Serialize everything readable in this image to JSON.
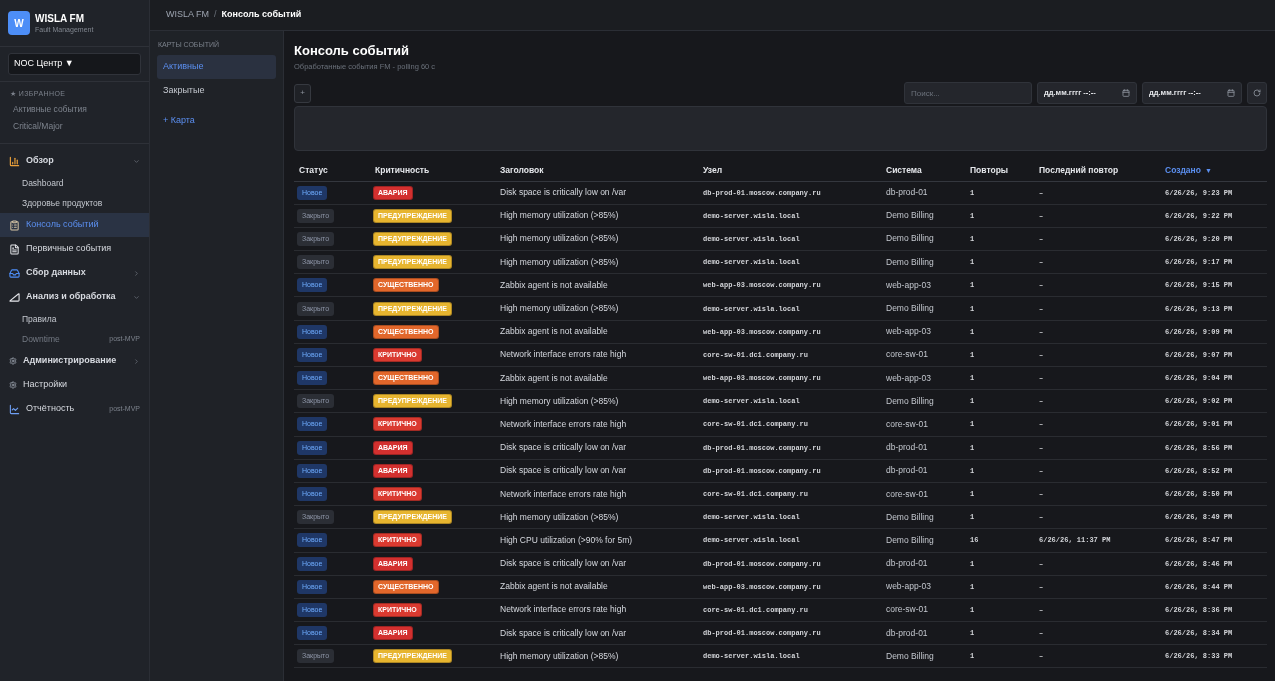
{
  "header": {
    "separator": "/",
    "breadcrumb": [
      {
        "label": "WISLA FM",
        "current": false
      },
      {
        "label": "Консоль событий",
        "current": true
      }
    ]
  },
  "sidebar": {
    "logo_letter": "W",
    "title": "WISLA FM",
    "subtitle": "Fault Management",
    "scope_select": {
      "value": "NOC Центр ▼"
    },
    "favorites": {
      "heading": "★ ИЗБРАННОЕ",
      "items": [
        "Активные события",
        "Critical/Major"
      ]
    },
    "nav": [
      {
        "kind": "group",
        "label": "Обзор",
        "expanded": true,
        "selected": false,
        "children": [
          {
            "label": "Dashboard",
            "selected": false,
            "disabled": false
          },
          {
            "label": "Здоровье продуктов",
            "selected": false,
            "disabled": false
          }
        ]
      },
      {
        "kind": "link",
        "label": "Консоль событий",
        "selected": true
      },
      {
        "kind": "link",
        "label": "Первичные события",
        "selected": false
      },
      {
        "kind": "group",
        "label": "Сбор данных",
        "expanded": false,
        "selected": false
      },
      {
        "kind": "group",
        "label": "Анализ и обработка",
        "expanded": true,
        "selected": false,
        "children": [
          {
            "label": "Правила",
            "selected": false,
            "disabled": false
          },
          {
            "label": "Downtime",
            "selected": false,
            "disabled": true,
            "tag": "post-MVP"
          }
        ]
      },
      {
        "kind": "group",
        "label": "Администрирование",
        "expanded": false,
        "selected": false
      },
      {
        "kind": "link",
        "label": "Настройки",
        "selected": false
      },
      {
        "kind": "link",
        "label": "Отчётность",
        "selected": false,
        "tag": "post-MVP"
      }
    ]
  },
  "maps": {
    "heading": "КАРТЫ СОБЫТИЙ",
    "items": [
      {
        "label": "Активные",
        "selected": true
      },
      {
        "label": "Закрытые",
        "selected": false
      }
    ],
    "add_link": "+ Карта"
  },
  "page": {
    "title": "Консоль событий",
    "subtitle": "Обработанные события FM - polling 60 с",
    "add_button": "+",
    "search": {
      "placeholder": "Поиск..."
    },
    "date_from": {
      "value": "дд.мм.гггг --:--"
    },
    "date_to": {
      "value": "дд.мм.гггг --:--"
    }
  },
  "table": {
    "columns": [
      {
        "label": "Статус",
        "sorted": false
      },
      {
        "label": "Критичность",
        "sorted": false
      },
      {
        "label": "Заголовок",
        "sorted": false
      },
      {
        "label": "Узел",
        "sorted": false
      },
      {
        "label": "Система",
        "sorted": false
      },
      {
        "label": "Повторы",
        "sorted": false
      },
      {
        "label": "Последний повтор",
        "sorted": false
      },
      {
        "label": "Создано",
        "sorted": true,
        "sort_indicator": "▼"
      }
    ],
    "rows": [
      {
        "status": {
          "label": "Новое",
          "color": "#1f3766"
        },
        "severity": {
          "label": "АВАРИЯ",
          "color": "#d3302f"
        },
        "title": "Disk space is critically low on /var",
        "host": "db-prod-01.moscow.company.ru",
        "system": "db-prod-01",
        "repeats": "1",
        "last_repeat": "–",
        "created": "6/26/26, 9:23 PM"
      },
      {
        "status": {
          "label": "Закрыто",
          "color": "#2b2e35"
        },
        "severity": {
          "label": "ПРЕДУПРЕЖДЕНИЕ",
          "color": "#e7b52f"
        },
        "title": "High memory utilization (>85%)",
        "host": "demo-server.wisla.local",
        "system": "Demo Billing",
        "repeats": "1",
        "last_repeat": "–",
        "created": "6/26/26, 9:22 PM"
      },
      {
        "status": {
          "label": "Закрыто",
          "color": "#2b2e35"
        },
        "severity": {
          "label": "ПРЕДУПРЕЖДЕНИЕ",
          "color": "#e7b52f"
        },
        "title": "High memory utilization (>85%)",
        "host": "demo-server.wisla.local",
        "system": "Demo Billing",
        "repeats": "1",
        "last_repeat": "–",
        "created": "6/26/26, 9:20 PM"
      },
      {
        "status": {
          "label": "Закрыто",
          "color": "#2b2e35"
        },
        "severity": {
          "label": "ПРЕДУПРЕЖДЕНИЕ",
          "color": "#e7b52f"
        },
        "title": "High memory utilization (>85%)",
        "host": "demo-server.wisla.local",
        "system": "Demo Billing",
        "repeats": "1",
        "last_repeat": "–",
        "created": "6/26/26, 9:17 PM"
      },
      {
        "status": {
          "label": "Новое",
          "color": "#1f3766"
        },
        "severity": {
          "label": "СУЩЕСТВЕННО",
          "color": "#e2672b"
        },
        "title": "Zabbix agent is not available",
        "host": "web-app-03.moscow.company.ru",
        "system": "web-app-03",
        "repeats": "1",
        "last_repeat": "–",
        "created": "6/26/26, 9:15 PM"
      },
      {
        "status": {
          "label": "Закрыто",
          "color": "#2b2e35"
        },
        "severity": {
          "label": "ПРЕДУПРЕЖДЕНИЕ",
          "color": "#e7b52f"
        },
        "title": "High memory utilization (>85%)",
        "host": "demo-server.wisla.local",
        "system": "Demo Billing",
        "repeats": "1",
        "last_repeat": "–",
        "created": "6/26/26, 9:13 PM"
      },
      {
        "status": {
          "label": "Новое",
          "color": "#1f3766"
        },
        "severity": {
          "label": "СУЩЕСТВЕННО",
          "color": "#e2672b"
        },
        "title": "Zabbix agent is not available",
        "host": "web-app-03.moscow.company.ru",
        "system": "web-app-03",
        "repeats": "1",
        "last_repeat": "–",
        "created": "6/26/26, 9:09 PM"
      },
      {
        "status": {
          "label": "Новое",
          "color": "#1f3766"
        },
        "severity": {
          "label": "КРИТИЧНО",
          "color": "#da3a30"
        },
        "title": "Network interface errors rate high",
        "host": "core-sw-01.dc1.company.ru",
        "system": "core-sw-01",
        "repeats": "1",
        "last_repeat": "–",
        "created": "6/26/26, 9:07 PM"
      },
      {
        "status": {
          "label": "Новое",
          "color": "#1f3766"
        },
        "severity": {
          "label": "СУЩЕСТВЕННО",
          "color": "#e2672b"
        },
        "title": "Zabbix agent is not available",
        "host": "web-app-03.moscow.company.ru",
        "system": "web-app-03",
        "repeats": "1",
        "last_repeat": "–",
        "created": "6/26/26, 9:04 PM"
      },
      {
        "status": {
          "label": "Закрыто",
          "color": "#2b2e35"
        },
        "severity": {
          "label": "ПРЕДУПРЕЖДЕНИЕ",
          "color": "#e7b52f"
        },
        "title": "High memory utilization (>85%)",
        "host": "demo-server.wisla.local",
        "system": "Demo Billing",
        "repeats": "1",
        "last_repeat": "–",
        "created": "6/26/26, 9:02 PM"
      },
      {
        "status": {
          "label": "Новое",
          "color": "#1f3766"
        },
        "severity": {
          "label": "КРИТИЧНО",
          "color": "#da3a30"
        },
        "title": "Network interface errors rate high",
        "host": "core-sw-01.dc1.company.ru",
        "system": "core-sw-01",
        "repeats": "1",
        "last_repeat": "–",
        "created": "6/26/26, 9:01 PM"
      },
      {
        "status": {
          "label": "Новое",
          "color": "#1f3766"
        },
        "severity": {
          "label": "АВАРИЯ",
          "color": "#d3302f"
        },
        "title": "Disk space is critically low on /var",
        "host": "db-prod-01.moscow.company.ru",
        "system": "db-prod-01",
        "repeats": "1",
        "last_repeat": "–",
        "created": "6/26/26, 8:56 PM"
      },
      {
        "status": {
          "label": "Новое",
          "color": "#1f3766"
        },
        "severity": {
          "label": "АВАРИЯ",
          "color": "#d3302f"
        },
        "title": "Disk space is critically low on /var",
        "host": "db-prod-01.moscow.company.ru",
        "system": "db-prod-01",
        "repeats": "1",
        "last_repeat": "–",
        "created": "6/26/26, 8:52 PM"
      },
      {
        "status": {
          "label": "Новое",
          "color": "#1f3766"
        },
        "severity": {
          "label": "КРИТИЧНО",
          "color": "#da3a30"
        },
        "title": "Network interface errors rate high",
        "host": "core-sw-01.dc1.company.ru",
        "system": "core-sw-01",
        "repeats": "1",
        "last_repeat": "–",
        "created": "6/26/26, 8:50 PM"
      },
      {
        "status": {
          "label": "Закрыто",
          "color": "#2b2e35"
        },
        "severity": {
          "label": "ПРЕДУПРЕЖДЕНИЕ",
          "color": "#e7b52f"
        },
        "title": "High memory utilization (>85%)",
        "host": "demo-server.wisla.local",
        "system": "Demo Billing",
        "repeats": "1",
        "last_repeat": "–",
        "created": "6/26/26, 8:49 PM"
      },
      {
        "status": {
          "label": "Новое",
          "color": "#1f3766"
        },
        "severity": {
          "label": "КРИТИЧНО",
          "color": "#da3a30"
        },
        "title": "High CPU utilization (>90% for 5m)",
        "host": "demo-server.wisla.local",
        "system": "Demo Billing",
        "repeats": "16",
        "last_repeat": "6/26/26, 11:37 PM",
        "created": "6/26/26, 8:47 PM"
      },
      {
        "status": {
          "label": "Новое",
          "color": "#1f3766"
        },
        "severity": {
          "label": "АВАРИЯ",
          "color": "#d3302f"
        },
        "title": "Disk space is critically low on /var",
        "host": "db-prod-01.moscow.company.ru",
        "system": "db-prod-01",
        "repeats": "1",
        "last_repeat": "–",
        "created": "6/26/26, 8:46 PM"
      },
      {
        "status": {
          "label": "Новое",
          "color": "#1f3766"
        },
        "severity": {
          "label": "СУЩЕСТВЕННО",
          "color": "#e2672b"
        },
        "title": "Zabbix agent is not available",
        "host": "web-app-03.moscow.company.ru",
        "system": "web-app-03",
        "repeats": "1",
        "last_repeat": "–",
        "created": "6/26/26, 8:44 PM"
      },
      {
        "status": {
          "label": "Новое",
          "color": "#1f3766"
        },
        "severity": {
          "label": "КРИТИЧНО",
          "color": "#da3a30"
        },
        "title": "Network interface errors rate high",
        "host": "core-sw-01.dc1.company.ru",
        "system": "core-sw-01",
        "repeats": "1",
        "last_repeat": "–",
        "created": "6/26/26, 8:36 PM"
      },
      {
        "status": {
          "label": "Новое",
          "color": "#1f3766"
        },
        "severity": {
          "label": "АВАРИЯ",
          "color": "#d3302f"
        },
        "title": "Disk space is critically low on /var",
        "host": "db-prod-01.moscow.company.ru",
        "system": "db-prod-01",
        "repeats": "1",
        "last_repeat": "–",
        "created": "6/26/26, 8:34 PM"
      },
      {
        "status": {
          "label": "Закрыто",
          "color": "#2b2e35"
        },
        "severity": {
          "label": "ПРЕДУПРЕЖДЕНИЕ",
          "color": "#e7b52f"
        },
        "title": "High memory utilization (>85%)",
        "host": "demo-server.wisla.local",
        "system": "Demo Billing",
        "repeats": "1",
        "last_repeat": "–",
        "created": "6/26/26, 8:33 PM"
      }
    ]
  }
}
